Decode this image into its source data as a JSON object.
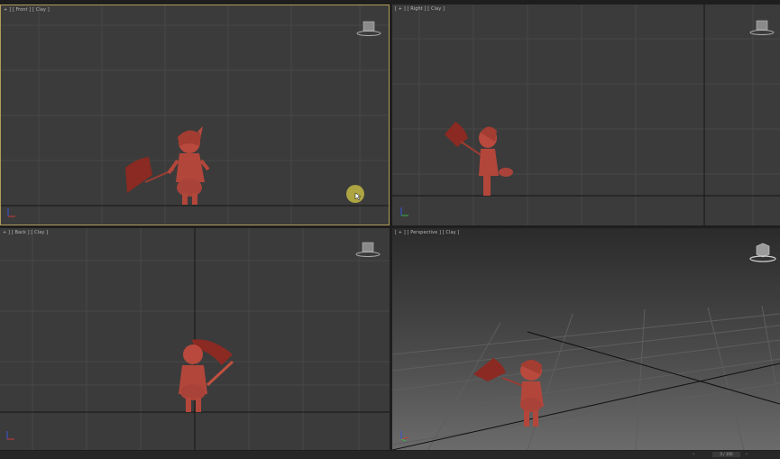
{
  "app": "3D modeling viewports",
  "viewports": {
    "front": {
      "label": "+ ] [ Front ] [ Clay ]",
      "active": true
    },
    "right": {
      "label": "[ + ] [ Right ] [ Clay ]",
      "active": false
    },
    "back": {
      "label": "+ ] [ Back ] [ Clay ]",
      "active": false
    },
    "perspective": {
      "label": "[ + ] [ Perspective ] [ Clay ]",
      "active": false
    }
  },
  "timeline": {
    "frame_counter": "0 / 100",
    "prev_icon": "chevron-left-icon",
    "next_icon": "chevron-right-icon"
  },
  "colors": {
    "viewport_bg": "#3b3b3b",
    "active_border": "#b29c5b",
    "clay": "#b5483a",
    "grid": "#4a4a4a",
    "horizon": "#0f0f0f"
  }
}
